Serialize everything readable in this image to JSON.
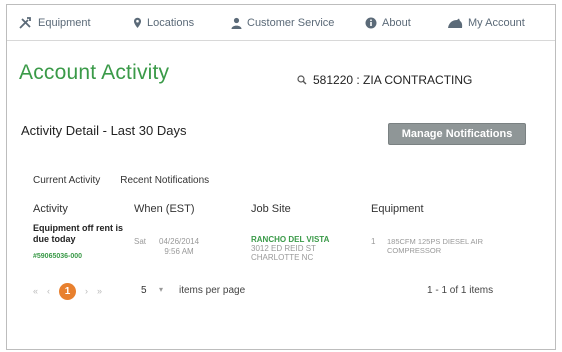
{
  "nav": {
    "equipment": "Equipment",
    "locations": "Locations",
    "customer_service": "Customer Service",
    "about": "About",
    "my_account": "My Account"
  },
  "page_title": "Account Activity",
  "account": "581220 : ZIA CONTRACTING",
  "section_title": "Activity Detail - Last 30 Days",
  "manage_button": "Manage Notifications",
  "tabs": [
    "Current Activity",
    "Recent Notifications"
  ],
  "table": {
    "headers": [
      "Activity",
      "When (EST)",
      "Job Site",
      "Equipment"
    ],
    "rows": [
      {
        "activity": "Equipment off rent is due today",
        "order": "#59065036-000",
        "day": "Sat",
        "date": "04/26/2014",
        "time": "9:56 AM",
        "site_name": "RANCHO DEL VISTA",
        "site_address": "3012 ED REID ST",
        "site_city": "CHARLOTTE NC",
        "quantity": "1",
        "equipment_line1": "185CFM 125PS DIESEL AIR",
        "equipment_line2": "COMPRESSOR"
      }
    ]
  },
  "pager": {
    "first": "«",
    "prev": "‹",
    "current_page": "1",
    "next": "›",
    "last": "»",
    "page_size": "5",
    "page_size_arrow": "▾",
    "items_per_page": "items per page",
    "count": "1 - 1 of 1 items"
  },
  "colors": {
    "brand_green": "#3a9a48",
    "button_gray": "#8f9697",
    "pager_orange": "#e8802e",
    "nav_text": "#5b6a78"
  }
}
